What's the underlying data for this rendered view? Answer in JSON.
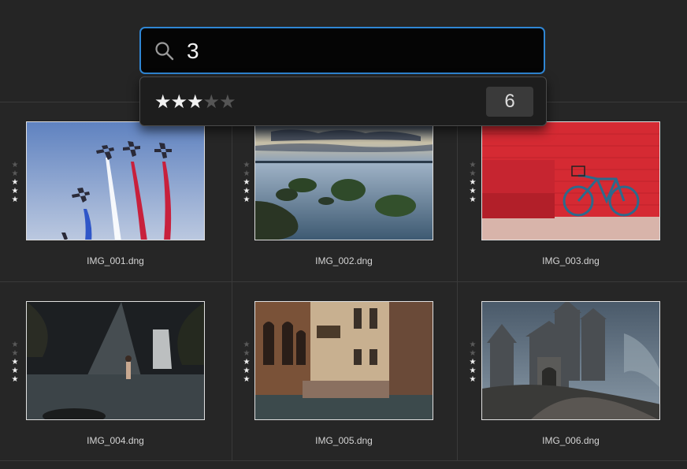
{
  "search": {
    "value": "3",
    "placeholder": ""
  },
  "dropdown": {
    "stars_filled": 3,
    "stars_total": 5,
    "count": "6"
  },
  "photos": [
    {
      "filename": "IMG_001.dng",
      "rating": 3
    },
    {
      "filename": "IMG_002.dng",
      "rating": 3
    },
    {
      "filename": "IMG_003.dng",
      "rating": 3
    },
    {
      "filename": "IMG_004.dng",
      "rating": 3
    },
    {
      "filename": "IMG_005.dng",
      "rating": 3
    },
    {
      "filename": "IMG_006.dng",
      "rating": 3
    }
  ],
  "colors": {
    "accent": "#2f86d4",
    "background": "#262626",
    "star_on": "#f0f0f0",
    "star_off": "#5a5a5a"
  }
}
